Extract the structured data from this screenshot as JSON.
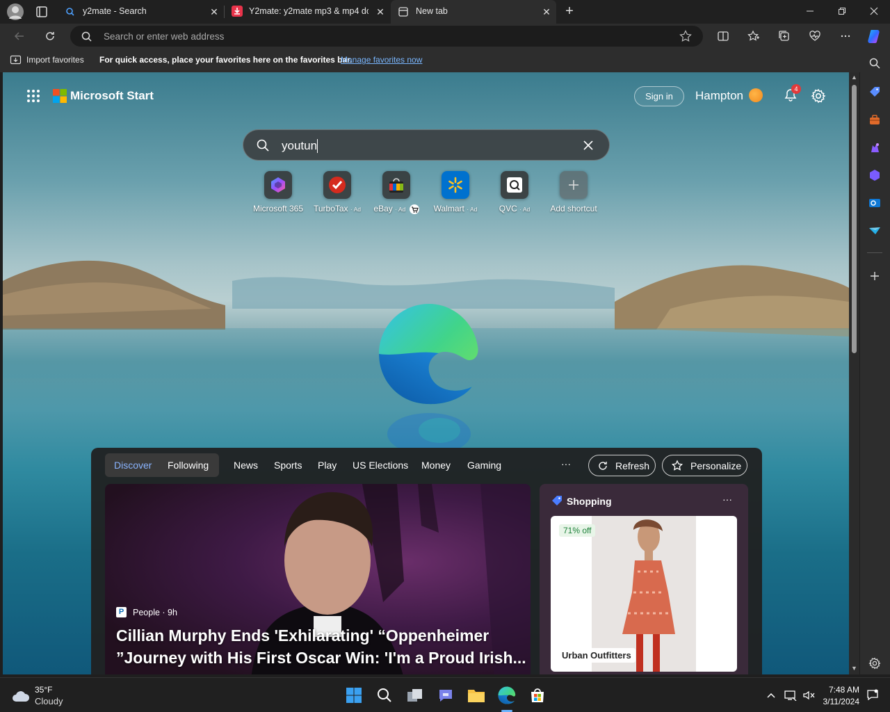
{
  "browser": {
    "tabs": [
      {
        "title": "y2mate - Search",
        "active": false
      },
      {
        "title": "Y2mate: y2mate mp3 & mp4 do",
        "active": false
      },
      {
        "title": "New tab",
        "active": true
      }
    ],
    "address_placeholder": "Search or enter web address"
  },
  "favorites_bar": {
    "import_label": "Import favorites",
    "message": "For quick access, place your favorites here on the favorites bar.",
    "manage_link": "Manage favorites now"
  },
  "start_page": {
    "brand": "Microsoft Start",
    "sign_in": "Sign in",
    "location": "Hampton",
    "notification_count": "4",
    "search_value": "youtun",
    "shortcuts": [
      {
        "label": "Microsoft 365",
        "ad": ""
      },
      {
        "label": "TurboTax",
        "ad": "· Ad"
      },
      {
        "label": "eBay",
        "ad": "· Ad"
      },
      {
        "label": "Walmart",
        "ad": "· Ad"
      },
      {
        "label": "QVC",
        "ad": "· Ad"
      },
      {
        "label": "Add shortcut",
        "ad": ""
      }
    ]
  },
  "feed": {
    "tabs": [
      "Discover",
      "Following",
      "News",
      "Sports",
      "Play",
      "US Elections",
      "Money",
      "Gaming"
    ],
    "more": "···",
    "refresh": "Refresh",
    "personalize": "Personalize",
    "hero": {
      "source": "People · 9h",
      "headline": "Cillian Murphy Ends 'Exhilarating' “Oppenheimer ”Journey with His First Oscar Win: 'I'm a Proud Irish..."
    },
    "shopping": {
      "title": "Shopping",
      "more": "···",
      "discount": "71% off",
      "store": "Urban Outfitters"
    }
  },
  "taskbar": {
    "weather_temp": "35°F",
    "weather_desc": "Cloudy",
    "time": "7:48 AM",
    "date": "3/11/2024"
  },
  "colors": {
    "accent_link": "#7ab7ff",
    "tab_bg": "#202020",
    "toolbar_bg": "#2d2d2d"
  }
}
